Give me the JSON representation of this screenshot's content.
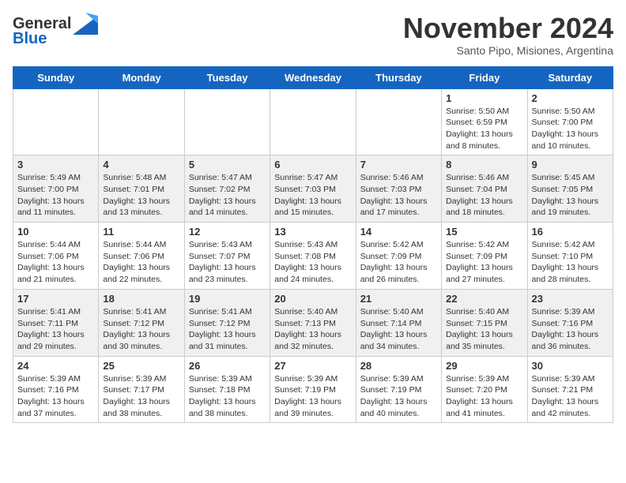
{
  "logo": {
    "text_general": "General",
    "text_blue": "Blue"
  },
  "title": "November 2024",
  "subtitle": "Santo Pipo, Misiones, Argentina",
  "weekdays": [
    "Sunday",
    "Monday",
    "Tuesday",
    "Wednesday",
    "Thursday",
    "Friday",
    "Saturday"
  ],
  "weeks": [
    [
      {
        "day": "",
        "info": ""
      },
      {
        "day": "",
        "info": ""
      },
      {
        "day": "",
        "info": ""
      },
      {
        "day": "",
        "info": ""
      },
      {
        "day": "",
        "info": ""
      },
      {
        "day": "1",
        "info": "Sunrise: 5:50 AM\nSunset: 6:59 PM\nDaylight: 13 hours\nand 8 minutes."
      },
      {
        "day": "2",
        "info": "Sunrise: 5:50 AM\nSunset: 7:00 PM\nDaylight: 13 hours\nand 10 minutes."
      }
    ],
    [
      {
        "day": "3",
        "info": "Sunrise: 5:49 AM\nSunset: 7:00 PM\nDaylight: 13 hours\nand 11 minutes."
      },
      {
        "day": "4",
        "info": "Sunrise: 5:48 AM\nSunset: 7:01 PM\nDaylight: 13 hours\nand 13 minutes."
      },
      {
        "day": "5",
        "info": "Sunrise: 5:47 AM\nSunset: 7:02 PM\nDaylight: 13 hours\nand 14 minutes."
      },
      {
        "day": "6",
        "info": "Sunrise: 5:47 AM\nSunset: 7:03 PM\nDaylight: 13 hours\nand 15 minutes."
      },
      {
        "day": "7",
        "info": "Sunrise: 5:46 AM\nSunset: 7:03 PM\nDaylight: 13 hours\nand 17 minutes."
      },
      {
        "day": "8",
        "info": "Sunrise: 5:46 AM\nSunset: 7:04 PM\nDaylight: 13 hours\nand 18 minutes."
      },
      {
        "day": "9",
        "info": "Sunrise: 5:45 AM\nSunset: 7:05 PM\nDaylight: 13 hours\nand 19 minutes."
      }
    ],
    [
      {
        "day": "10",
        "info": "Sunrise: 5:44 AM\nSunset: 7:06 PM\nDaylight: 13 hours\nand 21 minutes."
      },
      {
        "day": "11",
        "info": "Sunrise: 5:44 AM\nSunset: 7:06 PM\nDaylight: 13 hours\nand 22 minutes."
      },
      {
        "day": "12",
        "info": "Sunrise: 5:43 AM\nSunset: 7:07 PM\nDaylight: 13 hours\nand 23 minutes."
      },
      {
        "day": "13",
        "info": "Sunrise: 5:43 AM\nSunset: 7:08 PM\nDaylight: 13 hours\nand 24 minutes."
      },
      {
        "day": "14",
        "info": "Sunrise: 5:42 AM\nSunset: 7:09 PM\nDaylight: 13 hours\nand 26 minutes."
      },
      {
        "day": "15",
        "info": "Sunrise: 5:42 AM\nSunset: 7:09 PM\nDaylight: 13 hours\nand 27 minutes."
      },
      {
        "day": "16",
        "info": "Sunrise: 5:42 AM\nSunset: 7:10 PM\nDaylight: 13 hours\nand 28 minutes."
      }
    ],
    [
      {
        "day": "17",
        "info": "Sunrise: 5:41 AM\nSunset: 7:11 PM\nDaylight: 13 hours\nand 29 minutes."
      },
      {
        "day": "18",
        "info": "Sunrise: 5:41 AM\nSunset: 7:12 PM\nDaylight: 13 hours\nand 30 minutes."
      },
      {
        "day": "19",
        "info": "Sunrise: 5:41 AM\nSunset: 7:12 PM\nDaylight: 13 hours\nand 31 minutes."
      },
      {
        "day": "20",
        "info": "Sunrise: 5:40 AM\nSunset: 7:13 PM\nDaylight: 13 hours\nand 32 minutes."
      },
      {
        "day": "21",
        "info": "Sunrise: 5:40 AM\nSunset: 7:14 PM\nDaylight: 13 hours\nand 34 minutes."
      },
      {
        "day": "22",
        "info": "Sunrise: 5:40 AM\nSunset: 7:15 PM\nDaylight: 13 hours\nand 35 minutes."
      },
      {
        "day": "23",
        "info": "Sunrise: 5:39 AM\nSunset: 7:16 PM\nDaylight: 13 hours\nand 36 minutes."
      }
    ],
    [
      {
        "day": "24",
        "info": "Sunrise: 5:39 AM\nSunset: 7:16 PM\nDaylight: 13 hours\nand 37 minutes."
      },
      {
        "day": "25",
        "info": "Sunrise: 5:39 AM\nSunset: 7:17 PM\nDaylight: 13 hours\nand 38 minutes."
      },
      {
        "day": "26",
        "info": "Sunrise: 5:39 AM\nSunset: 7:18 PM\nDaylight: 13 hours\nand 38 minutes."
      },
      {
        "day": "27",
        "info": "Sunrise: 5:39 AM\nSunset: 7:19 PM\nDaylight: 13 hours\nand 39 minutes."
      },
      {
        "day": "28",
        "info": "Sunrise: 5:39 AM\nSunset: 7:19 PM\nDaylight: 13 hours\nand 40 minutes."
      },
      {
        "day": "29",
        "info": "Sunrise: 5:39 AM\nSunset: 7:20 PM\nDaylight: 13 hours\nand 41 minutes."
      },
      {
        "day": "30",
        "info": "Sunrise: 5:39 AM\nSunset: 7:21 PM\nDaylight: 13 hours\nand 42 minutes."
      }
    ]
  ]
}
